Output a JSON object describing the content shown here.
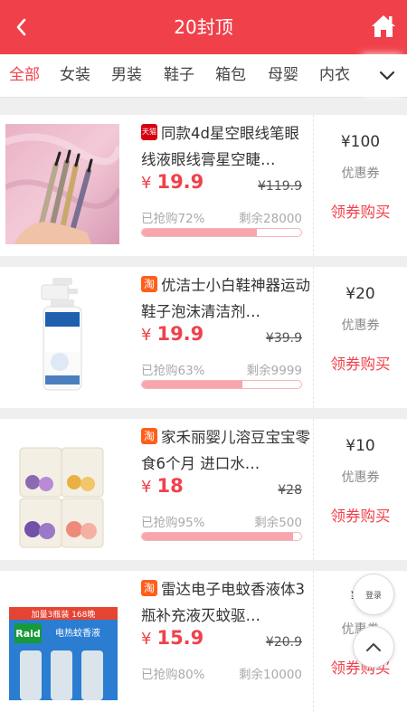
{
  "header": {
    "title": "20封顶"
  },
  "tabs": [
    {
      "label": "全部"
    },
    {
      "label": "女装"
    },
    {
      "label": "男装"
    },
    {
      "label": "鞋子"
    },
    {
      "label": "箱包"
    },
    {
      "label": "母婴"
    },
    {
      "label": "内衣"
    }
  ],
  "products": [
    {
      "platform": "天猫",
      "name": "同款4d星空眼线笔眼线液眼线膏星空睫…",
      "price": "19.9",
      "price_symbol": "¥",
      "original_price": "¥119.9",
      "sold": "已抢购72%",
      "sold_pct": 72,
      "remaining": "剩余28000",
      "coupon": "¥100",
      "coupon_label": "优惠券",
      "buy": "领券购买"
    },
    {
      "platform": "淘",
      "name": "优洁士小白鞋神器运动鞋子泡沫清洁剂…",
      "price": "19.9",
      "price_symbol": "¥",
      "original_price": "¥39.9",
      "sold": "已抢购63%",
      "sold_pct": 63,
      "remaining": "剩余9999",
      "coupon": "¥20",
      "coupon_label": "优惠券",
      "buy": "领券购买"
    },
    {
      "platform": "淘",
      "name": "家禾丽婴儿溶豆宝宝零食6个月 进口水…",
      "price": "18",
      "price_symbol": "¥",
      "original_price": "¥28",
      "sold": "已抢购95%",
      "sold_pct": 95,
      "remaining": "剩余500",
      "coupon": "¥10",
      "coupon_label": "优惠券",
      "buy": "领券购买"
    },
    {
      "platform": "淘",
      "name": "雷达电子电蚊香液体3瓶补充液灭蚊驱…",
      "price": "15.9",
      "price_symbol": "¥",
      "original_price": "¥20.9",
      "sold": "已抢购80%",
      "sold_pct": 80,
      "remaining": "剩余10000",
      "coupon": "¥5",
      "coupon_label": "优惠券",
      "buy": "领券购买"
    }
  ],
  "product_images": {
    "raid_label_top": "加量3瓶装  168晚",
    "raid_brand": "Raid",
    "raid_label": "电热蚊香液"
  },
  "floating": {
    "login_label": "登录"
  },
  "colors": {
    "accent": "#f0414b",
    "progress": "#f6a6ac"
  },
  "icons": {
    "back": "chevron-left-icon",
    "home": "home-icon",
    "more": "chevron-down-icon",
    "top": "chevron-up-icon"
  }
}
